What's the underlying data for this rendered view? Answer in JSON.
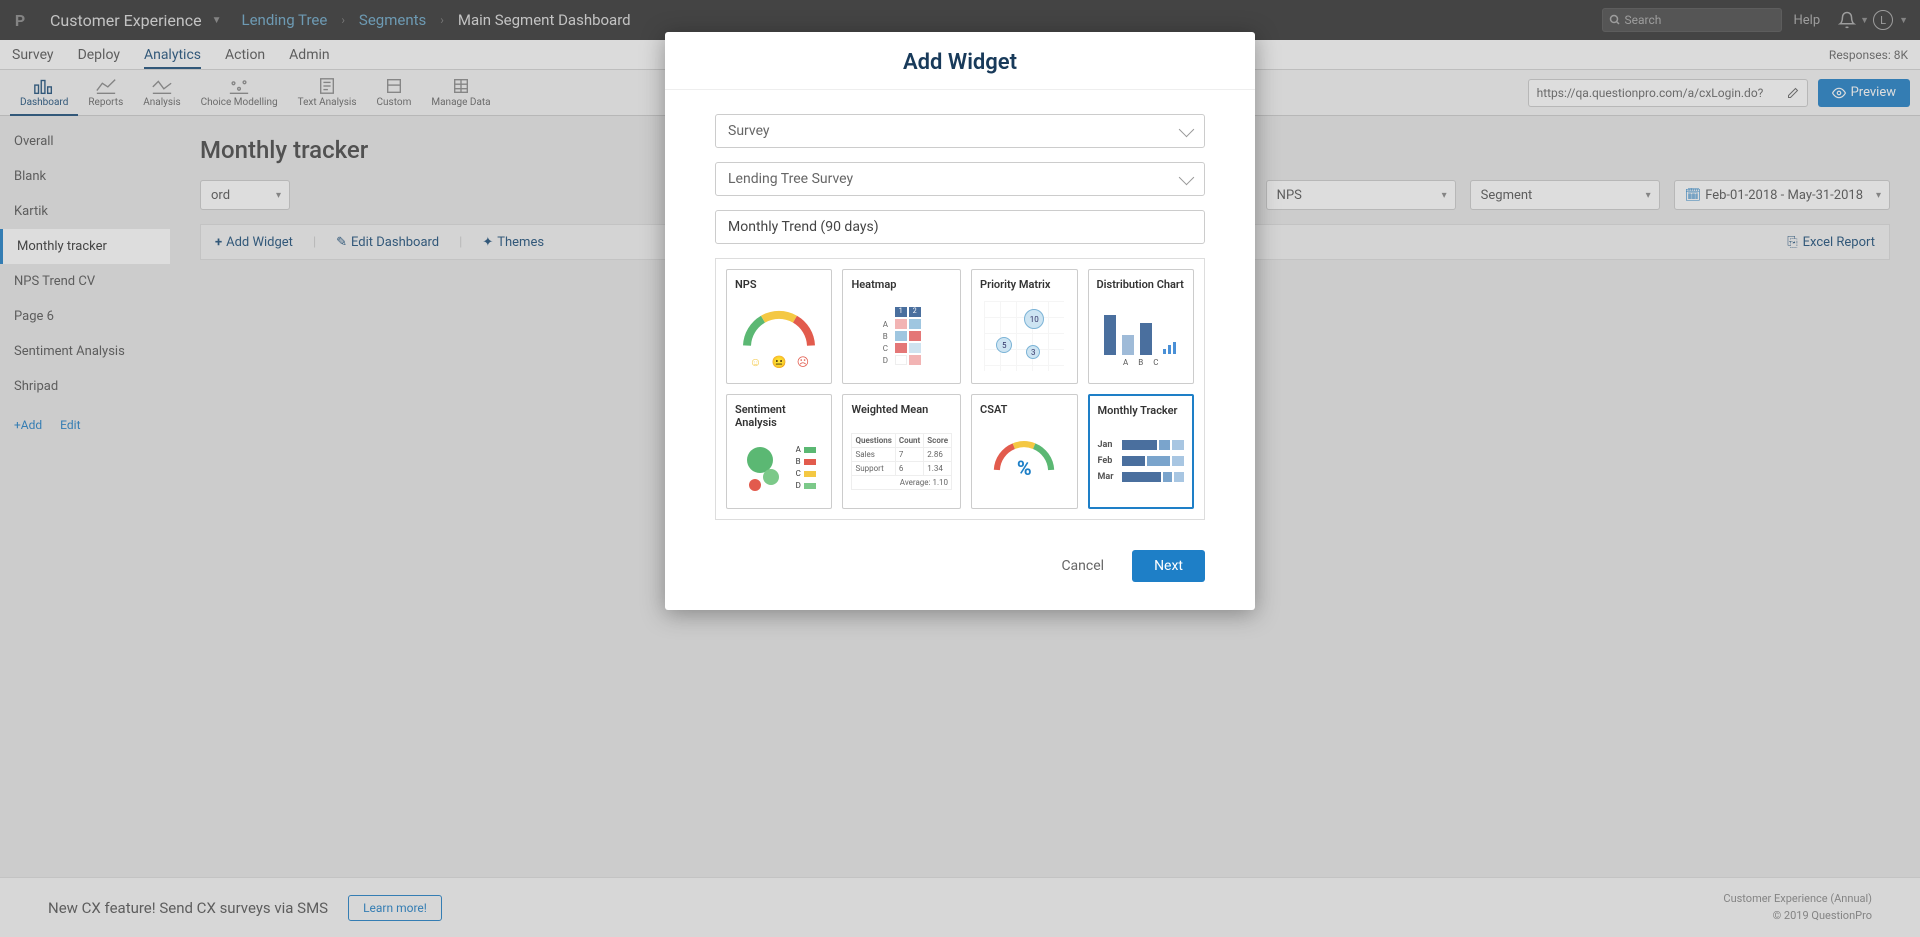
{
  "topbar": {
    "brand": "Customer Experience",
    "breadcrumbs": [
      "Lending Tree",
      "Segments",
      "Main Segment Dashboard"
    ],
    "search_placeholder": "Search",
    "help": "Help",
    "avatar_initial": "L"
  },
  "nav2": {
    "items": [
      "Survey",
      "Deploy",
      "Analytics",
      "Action",
      "Admin"
    ],
    "active": "Analytics",
    "responses_label": "Responses: 8K"
  },
  "toolbar": {
    "items": [
      "Dashboard",
      "Reports",
      "Analysis",
      "Choice Modelling",
      "Text Analysis",
      "Custom",
      "Manage Data"
    ],
    "active": "Dashboard",
    "url": "https://qa.questionpro.com/a/cxLogin.do?",
    "preview": "Preview"
  },
  "sidebar": {
    "items": [
      "Overall",
      "Blank",
      "Kartik",
      "Monthly tracker",
      "NPS Trend CV",
      "Page 6",
      "Sentiment Analysis",
      "Shripad"
    ],
    "active": "Monthly tracker",
    "add": "+Add",
    "edit": "Edit"
  },
  "main": {
    "title": "Monthly tracker",
    "filters": {
      "order": "ord",
      "nps": "NPS",
      "segment": "Segment",
      "date": "Feb-01-2018 - May-31-2018"
    },
    "actions": {
      "add_widget": "Add Widget",
      "edit_dashboard": "Edit Dashboard",
      "themes": "Themes",
      "excel": "Excel Report"
    }
  },
  "footer": {
    "text": "New CX feature! Send CX surveys via SMS",
    "learn": "Learn more!",
    "line1": "Customer Experience (Annual)",
    "line2": "© 2019 QuestionPro"
  },
  "modal": {
    "title": "Add Widget",
    "select1": "Survey",
    "select2": "Lending Tree Survey",
    "name": "Monthly Trend (90 days)",
    "widgets": [
      "NPS",
      "Heatmap",
      "Priority Matrix",
      "Distribution Chart",
      "Sentiment Analysis",
      "Weighted Mean",
      "CSAT",
      "Monthly Tracker"
    ],
    "selected": "Monthly Tracker",
    "cancel": "Cancel",
    "next": "Next",
    "monthly_rows": [
      "Jan",
      "Feb",
      "Mar"
    ],
    "wm_rows": [
      [
        "Questions",
        "Count",
        "Score"
      ],
      [
        "Sales",
        "7",
        "2.86"
      ],
      [
        "Support",
        "6",
        "1.34"
      ],
      [
        "Average: 1.10"
      ]
    ],
    "matrix_bubbles": [
      "10",
      "5",
      "3"
    ],
    "heatmap_header": [
      "1",
      "2"
    ],
    "heatmap_labels": [
      "A",
      "B",
      "C",
      "D"
    ]
  }
}
